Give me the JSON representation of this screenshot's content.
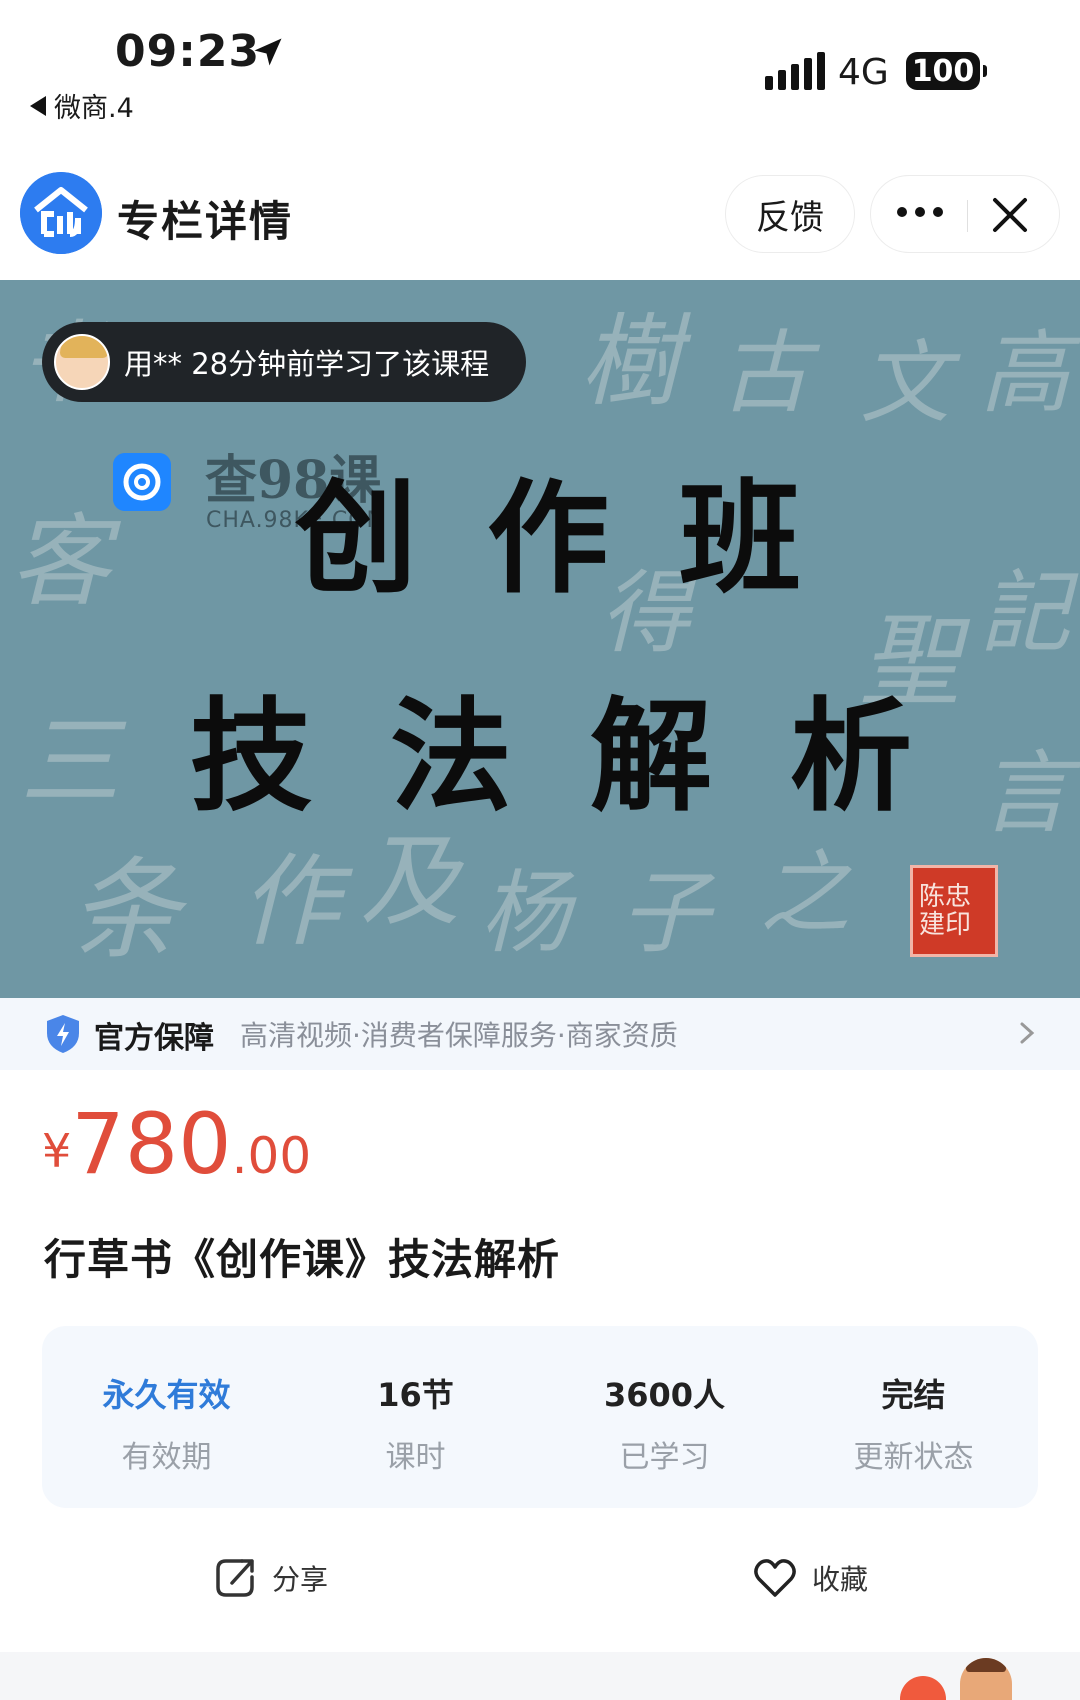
{
  "status_bar": {
    "time": "09:23",
    "back_app": "微商.4",
    "network": "4G",
    "battery": "100"
  },
  "header": {
    "title": "专栏详情",
    "feedback": "反馈"
  },
  "banner": {
    "learner_notice": "用** 28分钟前学习了该课程",
    "watermark_title": "查98课",
    "watermark_url": "CHA.98KE.COM",
    "cover_line1": "创作班",
    "cover_line2": "技法解析",
    "seal_text": "陈忠建印"
  },
  "guarantee": {
    "title": "官方保障",
    "desc": "高清视频·消费者保障服务·商家资质"
  },
  "price": {
    "currency": "¥",
    "integer": "780",
    "decimal": ".00"
  },
  "course_title": "行草书《创作课》技法解析",
  "stats": [
    {
      "value": "永久有效",
      "label": "有效期"
    },
    {
      "value": "16节",
      "label": "课时"
    },
    {
      "value": "3600人",
      "label": "已学习"
    },
    {
      "value": "完结",
      "label": "更新状态"
    }
  ],
  "actions": {
    "share": "分享",
    "favorite": "收藏"
  },
  "colors": {
    "accent_red": "#e04d3b",
    "accent_blue": "#2f7bd9",
    "banner_bg": "#6f97a4"
  }
}
